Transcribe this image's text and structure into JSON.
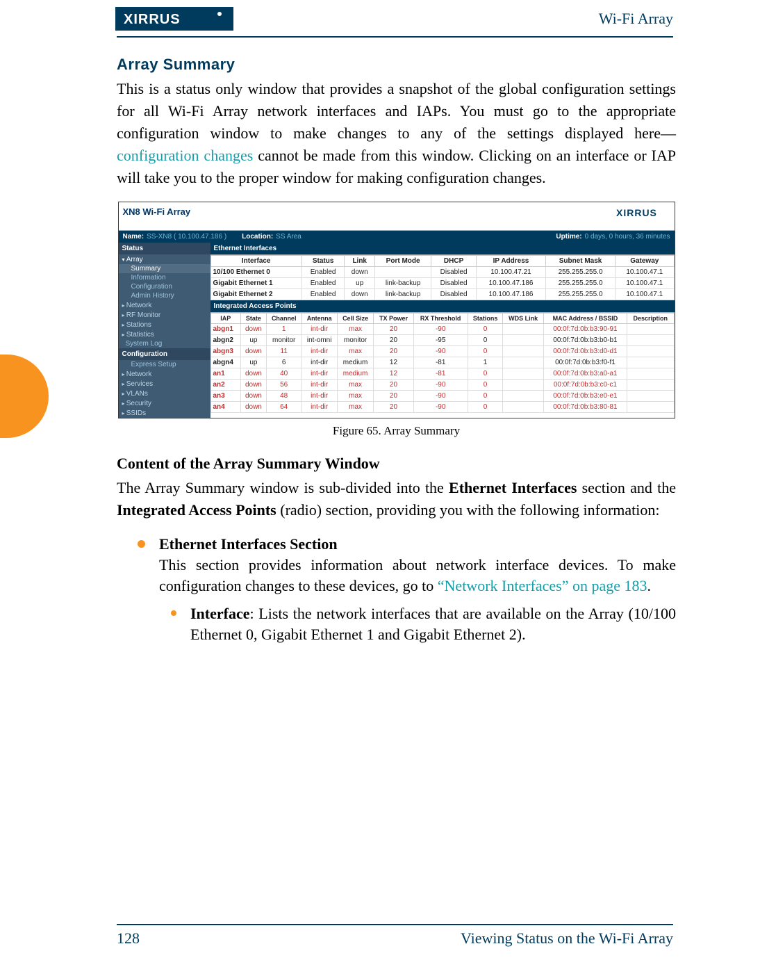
{
  "header": {
    "brand": "XIRRUS",
    "right": "Wi-Fi Array"
  },
  "section_title": "Array Summary",
  "intro_before_link": "This is a status only window that provides a snapshot of the global configuration settings for all Wi-Fi Array network interfaces and IAPs. You must go to the appropriate configuration window to make changes to any of the settings displayed here—",
  "intro_link_text": "configuration changes",
  "intro_after_link": " cannot be made from this window. Clicking on an interface or IAP will take you to the proper window for making configuration changes.",
  "figure_caption": "Figure 65. Array Summary",
  "subhead": "Content of the Array Summary Window",
  "para2_a": "The Array Summary window is sub-divided into the ",
  "para2_b": "Ethernet Interfaces",
  "para2_c": " section and the ",
  "para2_d": "Integrated Access Points",
  "para2_e": " (radio) section, providing you with the following information:",
  "bullet1_title": "Ethernet Interfaces Section",
  "bullet1_text_a": "This section provides information about network interface devices. To make configuration changes to these devices, go to ",
  "bullet1_link": "“Network Interfaces” on page 183",
  "bullet1_text_b": ".",
  "bullet2_label": "Interface",
  "bullet2_text": ": Lists the network interfaces that are available on the Array (10/100 Ethernet 0, Gigabit Ethernet 1 and Gigabit Ethernet 2).",
  "footer": {
    "page_num": "128",
    "title": "Viewing Status on the Wi-Fi Array"
  },
  "shot": {
    "device_name": "XN8 Wi-Fi Array",
    "minilogo": "XIRRUS",
    "status": {
      "name_lbl": "Name:",
      "name_val": "SS-XN8   ( 10.100.47.186 )",
      "loc_lbl": "Location:",
      "loc_val": "SS Area",
      "up_lbl": "Uptime:",
      "up_val": "0 days, 0 hours, 36 minutes"
    },
    "sidebar": {
      "top_sec": "Status",
      "array": "Array",
      "items": [
        "Summary",
        "Information",
        "Configuration",
        "Admin History"
      ],
      "closed1": [
        "Network",
        "RF Monitor",
        "Stations",
        "Statistics"
      ],
      "loose": "System Log",
      "config_sec": "Configuration",
      "config_child": "Express Setup",
      "closed2": [
        "Network",
        "Services",
        "VLANs",
        "Security",
        "SSIDs"
      ]
    },
    "eth": {
      "bar": "Ethernet Interfaces",
      "head": [
        "Interface",
        "Status",
        "Link",
        "Port Mode",
        "DHCP",
        "IP Address",
        "Subnet Mask",
        "Gateway"
      ],
      "rows": [
        [
          "10/100 Ethernet 0",
          "Enabled",
          "down",
          "",
          "Disabled",
          "10.100.47.21",
          "255.255.255.0",
          "10.100.47.1"
        ],
        [
          "Gigabit Ethernet 1",
          "Enabled",
          "up",
          "link-backup",
          "Disabled",
          "10.100.47.186",
          "255.255.255.0",
          "10.100.47.1"
        ],
        [
          "Gigabit Ethernet 2",
          "Enabled",
          "down",
          "link-backup",
          "Disabled",
          "10.100.47.186",
          "255.255.255.0",
          "10.100.47.1"
        ]
      ]
    },
    "iap": {
      "bar": "Integrated Access Points",
      "head": [
        "IAP",
        "State",
        "Channel",
        "Antenna",
        "Cell Size",
        "TX Power",
        "RX Threshold",
        "Stations",
        "WDS Link",
        "MAC Address / BSSID",
        "Description"
      ],
      "rows": [
        {
          "r": [
            "abgn1",
            "down",
            "1",
            "int-dir",
            "max",
            "20",
            "-90",
            "0",
            "",
            "00:0f:7d:0b:b3:90-91",
            ""
          ],
          "red": true
        },
        {
          "r": [
            "abgn2",
            "up",
            "monitor",
            "int-omni",
            "monitor",
            "20",
            "-95",
            "0",
            "",
            "00:0f:7d:0b:b3:b0-b1",
            ""
          ],
          "red": false
        },
        {
          "r": [
            "abgn3",
            "down",
            "11",
            "int-dir",
            "max",
            "20",
            "-90",
            "0",
            "",
            "00:0f:7d:0b:b3:d0-d1",
            ""
          ],
          "red": true
        },
        {
          "r": [
            "abgn4",
            "up",
            "6",
            "int-dir",
            "medium",
            "12",
            "-81",
            "1",
            "",
            "00:0f:7d:0b:b3:f0-f1",
            ""
          ],
          "red": false
        },
        {
          "r": [
            "an1",
            "down",
            "40",
            "int-dir",
            "medium",
            "12",
            "-81",
            "0",
            "",
            "00:0f:7d:0b:b3:a0-a1",
            ""
          ],
          "red": true
        },
        {
          "r": [
            "an2",
            "down",
            "56",
            "int-dir",
            "max",
            "20",
            "-90",
            "0",
            "",
            "00:0f:7d:0b:b3:c0-c1",
            ""
          ],
          "red": true
        },
        {
          "r": [
            "an3",
            "down",
            "48",
            "int-dir",
            "max",
            "20",
            "-90",
            "0",
            "",
            "00:0f:7d:0b:b3:e0-e1",
            ""
          ],
          "red": true
        },
        {
          "r": [
            "an4",
            "down",
            "64",
            "int-dir",
            "max",
            "20",
            "-90",
            "0",
            "",
            "00:0f:7d:0b:b3:80-81",
            ""
          ],
          "red": true
        }
      ]
    }
  }
}
